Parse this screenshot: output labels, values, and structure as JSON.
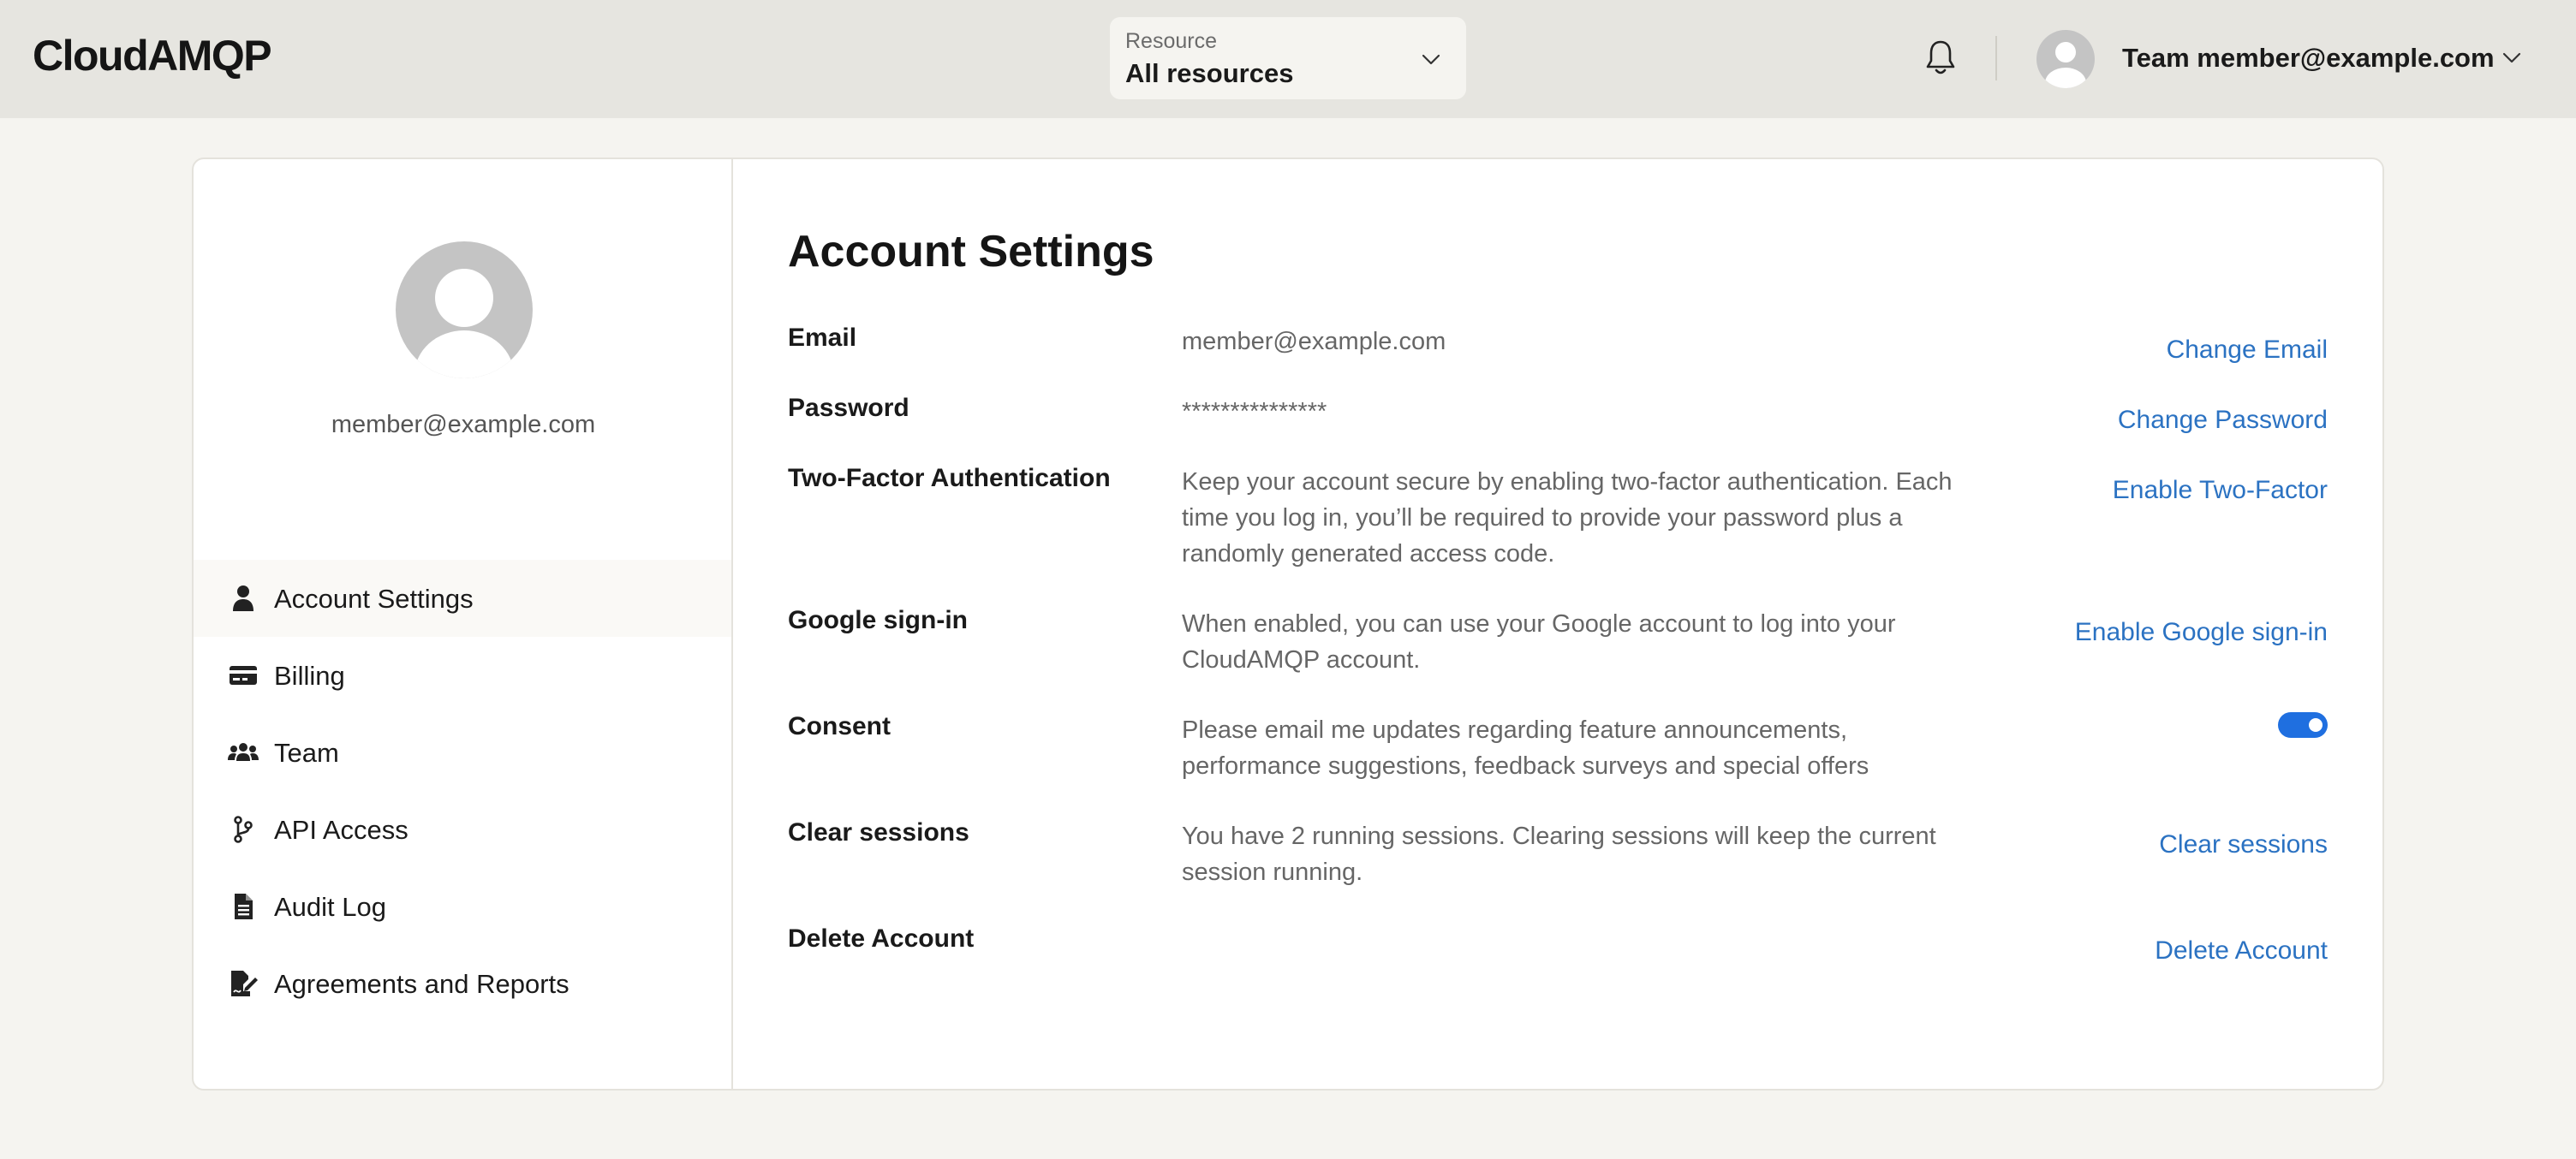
{
  "header": {
    "logo": "CloudAMQP",
    "resource_label": "Resource",
    "resource_value": "All resources",
    "user_label": "Team member@example.com"
  },
  "sidebar": {
    "email": "member@example.com",
    "items": [
      {
        "label": "Account Settings",
        "icon": "user-icon",
        "active": true
      },
      {
        "label": "Billing",
        "icon": "credit-card-icon",
        "active": false
      },
      {
        "label": "Team",
        "icon": "users-icon",
        "active": false
      },
      {
        "label": "API Access",
        "icon": "code-branch-icon",
        "active": false
      },
      {
        "label": "Audit Log",
        "icon": "document-icon",
        "active": false
      },
      {
        "label": "Agreements and Reports",
        "icon": "signature-icon",
        "active": false
      }
    ]
  },
  "main": {
    "title": "Account Settings",
    "rows": [
      {
        "label": "Email",
        "value": "member@example.com",
        "action": "Change Email"
      },
      {
        "label": "Password",
        "value": "***************",
        "action": "Change Password"
      },
      {
        "label": "Two-Factor Authentication",
        "value": "Keep your account secure by enabling two-factor authentication. Each time you log in, you’ll be required to provide your password plus a randomly generated access code.",
        "action": "Enable Two-Factor"
      },
      {
        "label": "Google sign-in",
        "value": "When enabled, you can use your Google account to log into your CloudAMQP account.",
        "action": "Enable Google sign-in"
      },
      {
        "label": "Consent",
        "value": "Please email me updates regarding feature announcements, performance suggestions, feedback surveys and special offers",
        "toggle_on": true
      },
      {
        "label": "Clear sessions",
        "value": "You have 2 running sessions. Clearing sessions will keep the current session running.",
        "action": "Clear sessions"
      },
      {
        "label": "Delete Account",
        "value": "",
        "action": "Delete Account"
      }
    ]
  },
  "colors": {
    "link": "#2b72c2",
    "toggle": "#1f6fe0",
    "topbar": "#e6e5e0",
    "page_bg": "#f5f4f0"
  }
}
